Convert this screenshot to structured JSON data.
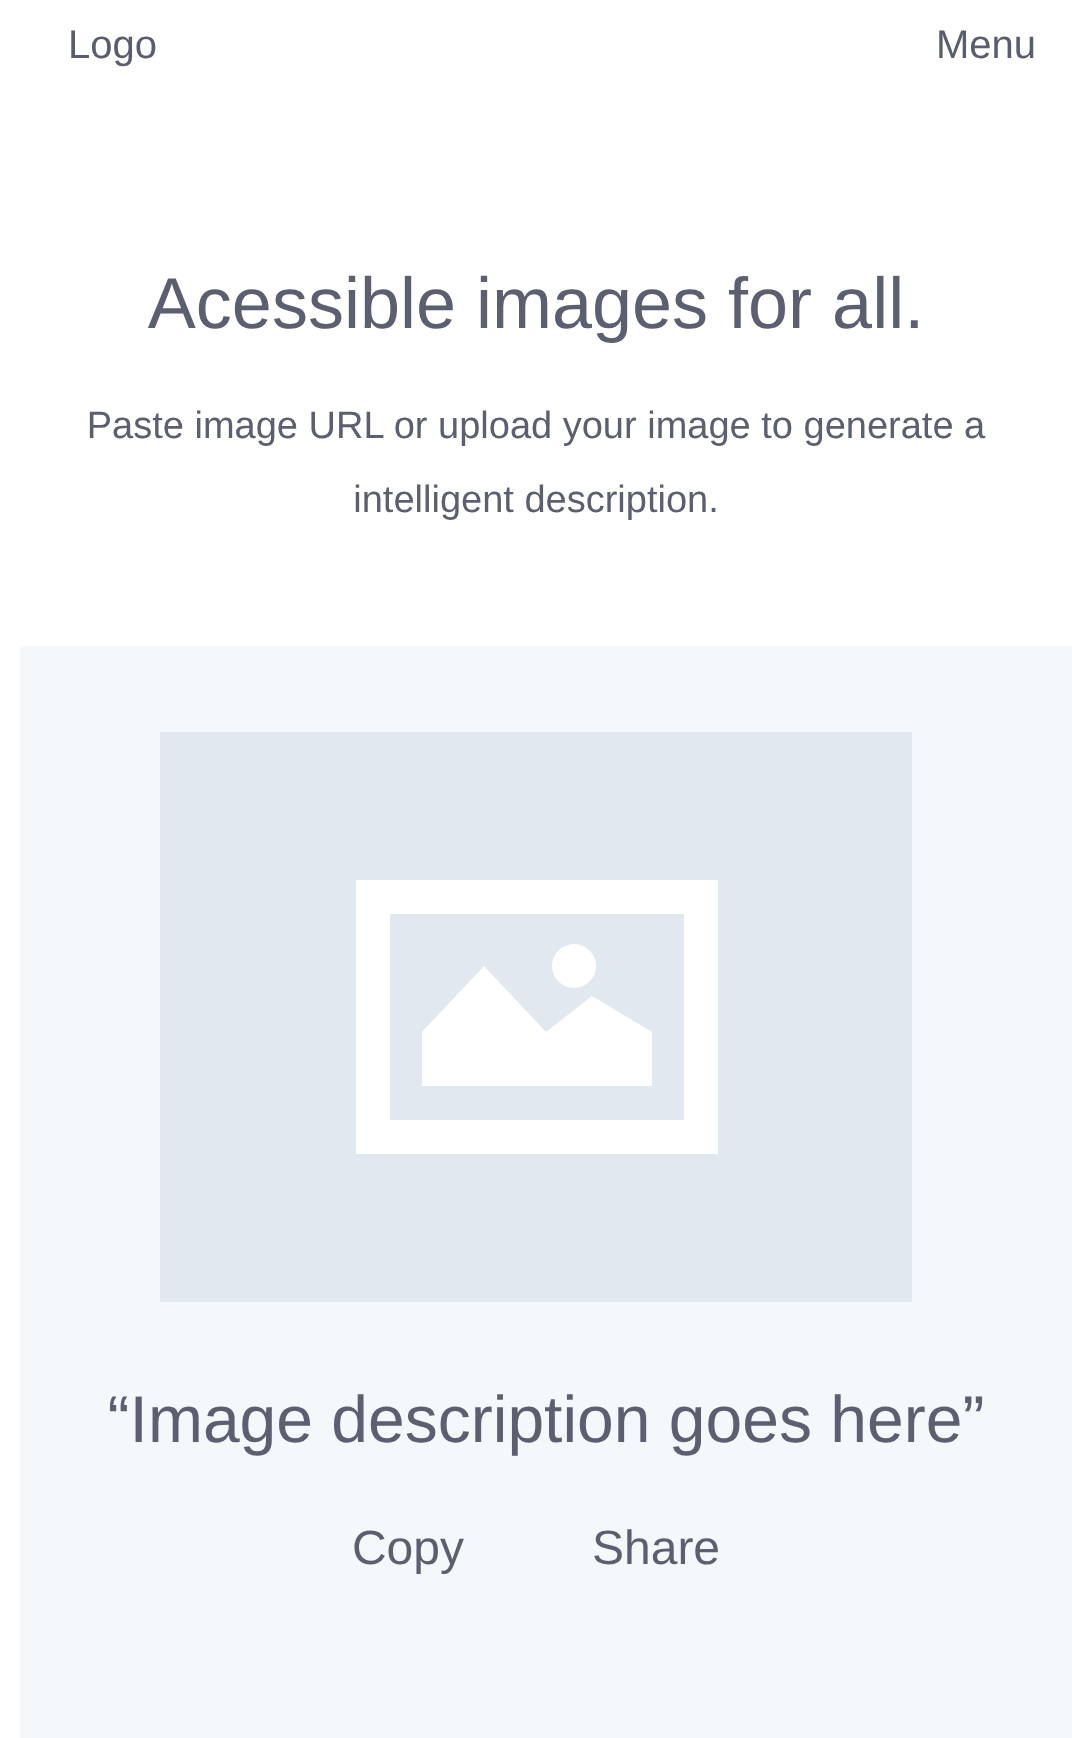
{
  "header": {
    "logo": "Logo",
    "menu": "Menu"
  },
  "hero": {
    "title": "Acessible images for all.",
    "subtitle": "Paste image URL or upload your image to generate a intelligent description."
  },
  "result": {
    "description": "“Image description goes here”",
    "actions": [
      "Copy",
      "Share"
    ]
  }
}
